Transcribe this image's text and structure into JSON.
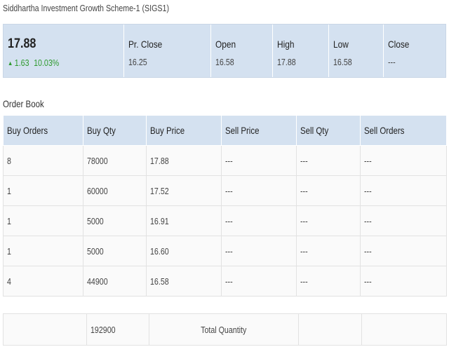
{
  "title": "Siddhartha Investment Growth Scheme-1 (SIGS1)",
  "quote": {
    "ltp": "17.88",
    "change": "1.63",
    "change_pct": "10.03%",
    "up_color": "#2e9a2e",
    "fields": [
      {
        "label": "Pr. Close",
        "value": "16.25"
      },
      {
        "label": "Open",
        "value": "16.58"
      },
      {
        "label": "High",
        "value": "17.88"
      },
      {
        "label": "Low",
        "value": "16.58"
      },
      {
        "label": "Close",
        "value": "---"
      }
    ]
  },
  "order_book": {
    "heading": "Order Book",
    "columns": [
      "Buy Orders",
      "Buy Qty",
      "Buy Price",
      "Sell Price",
      "Sell Qty",
      "Sell Orders"
    ],
    "rows": [
      [
        "8",
        "78000",
        "17.88",
        "---",
        "---",
        "---"
      ],
      [
        "1",
        "60000",
        "17.52",
        "---",
        "---",
        "---"
      ],
      [
        "1",
        "5000",
        "16.91",
        "---",
        "---",
        "---"
      ],
      [
        "1",
        "5000",
        "16.60",
        "---",
        "---",
        "---"
      ],
      [
        "4",
        "44900",
        "16.58",
        "---",
        "---",
        "---"
      ]
    ],
    "total_qty": "192900",
    "total_label": "Total Quantity"
  },
  "colors": {
    "header_bg": "#d4e1f0",
    "row_bg": "#fafafa"
  }
}
